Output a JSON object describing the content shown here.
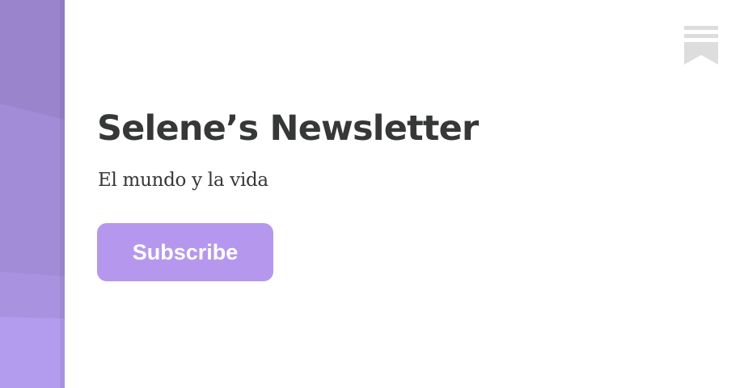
{
  "publication": {
    "title": "Selene’s Newsletter",
    "tagline": "El mundo y la vida"
  },
  "actions": {
    "subscribe_label": "Subscribe"
  },
  "brand": {
    "logo_icon": "bookmark-logo-icon",
    "accent_color": "#b598ee",
    "side_band_colors": [
      "#9a84cc",
      "#a58fdb",
      "#ae97e6",
      "#b59ef0"
    ],
    "text_color": "#363737",
    "logo_color": "#dddddd"
  }
}
